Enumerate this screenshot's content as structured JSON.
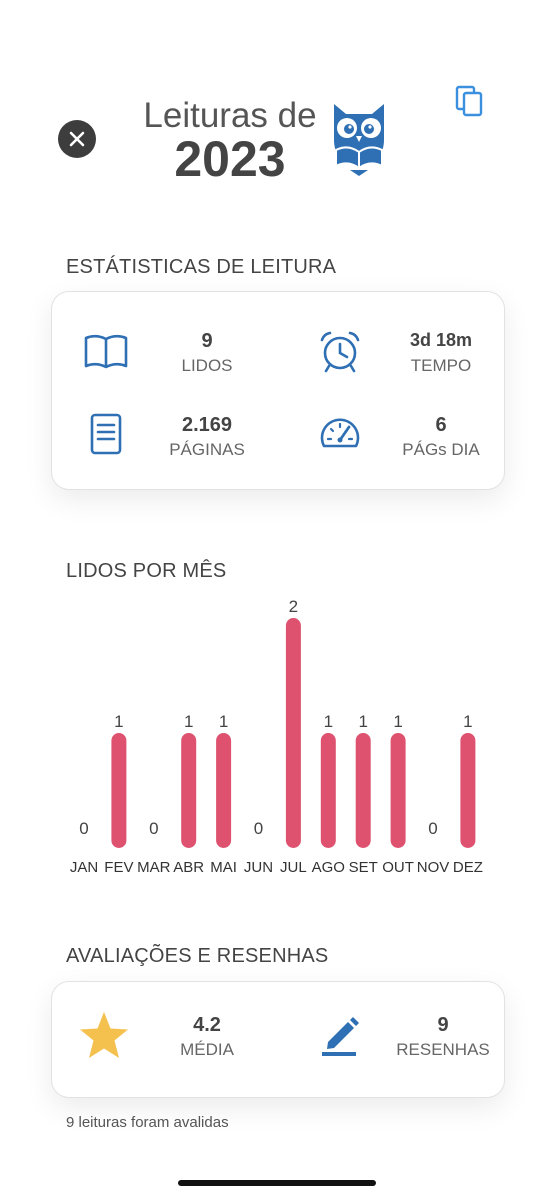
{
  "header": {
    "title_line1": "Leituras de",
    "year": "2023"
  },
  "reading_stats": {
    "section_title": "ESTÁTISTICAS DE LEITURA",
    "items": [
      {
        "value": "9",
        "label": "LIDOS",
        "icon": "open-book-icon"
      },
      {
        "value": "3d 18m",
        "label": "TEMPO",
        "icon": "alarm-clock-icon"
      },
      {
        "value": "2.169",
        "label": "PÁGINAS",
        "icon": "document-icon"
      },
      {
        "value": "6",
        "label": "PÁGs DIA",
        "icon": "speedometer-icon"
      }
    ]
  },
  "monthly": {
    "section_title": "LIDOS POR MÊS"
  },
  "chart_data": {
    "type": "bar",
    "categories": [
      "JAN",
      "FEV",
      "MAR",
      "ABR",
      "MAI",
      "JUN",
      "JUL",
      "AGO",
      "SET",
      "OUT",
      "NOV",
      "DEZ"
    ],
    "values": [
      0,
      1,
      0,
      1,
      1,
      0,
      2,
      1,
      1,
      1,
      0,
      1
    ],
    "ylim": [
      0,
      2
    ],
    "bar_color": "#de5270",
    "grid": false
  },
  "ratings": {
    "section_title": "AVALIAÇÕES E RESENHAS",
    "average": {
      "value": "4.2",
      "label": "MÉDIA",
      "icon": "star-icon"
    },
    "reviews": {
      "value": "9",
      "label": "RESENHAS",
      "icon": "pencil-icon"
    },
    "footnote": "9 leituras foram avalidas"
  },
  "colors": {
    "accent_blue": "#2f6fb3",
    "star_yellow": "#f4c14e",
    "bar_red": "#de5270"
  }
}
